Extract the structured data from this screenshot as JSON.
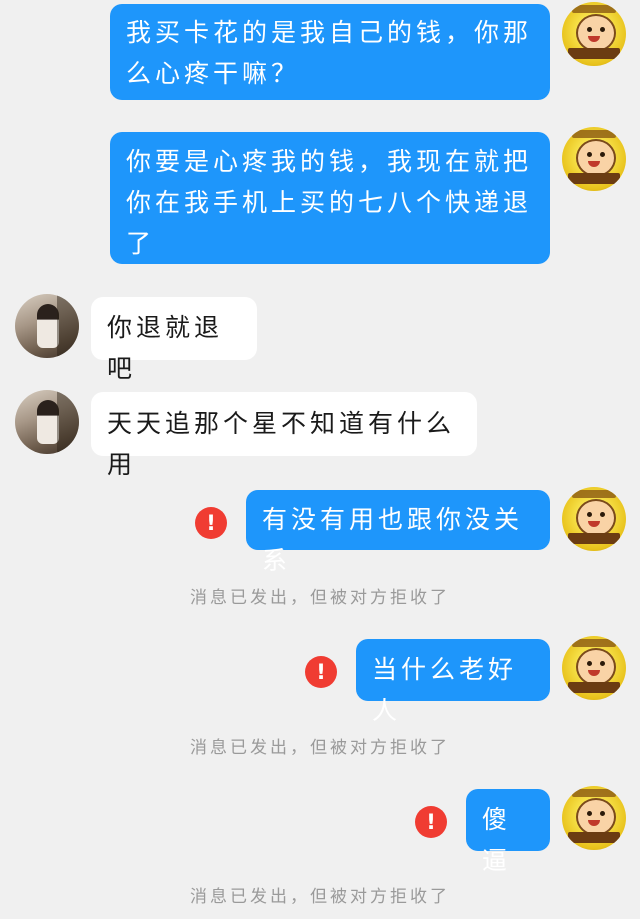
{
  "messages": [
    {
      "direction": "sent",
      "text": "我买卡花的是我自己的钱，你那么心疼干嘛？"
    },
    {
      "direction": "sent",
      "text": "你要是心疼我的钱，我现在就把你在我手机上买的七八个快递退了"
    },
    {
      "direction": "received",
      "text": "你退就退吧"
    },
    {
      "direction": "received",
      "text": "天天追那个星不知道有什么用"
    },
    {
      "direction": "sent",
      "text": "有没有用也跟你没关系",
      "failed": true,
      "error_icon": "exclamation-icon",
      "notice": "消息已发出，但被对方拒收了"
    },
    {
      "direction": "sent",
      "text": "当什么老好人",
      "failed": true,
      "error_icon": "exclamation-icon",
      "notice": "消息已发出，但被对方拒收了"
    },
    {
      "direction": "sent",
      "text": "傻逼",
      "failed": true,
      "error_icon": "exclamation-icon",
      "notice": "消息已发出，但被对方拒收了"
    }
  ],
  "error_glyph": "!",
  "colors": {
    "background": "#f0f0f0",
    "sent_bubble": "#1e96fb",
    "received_bubble": "#ffffff",
    "error": "#f03c32",
    "notice_text": "#9a9a9a"
  }
}
